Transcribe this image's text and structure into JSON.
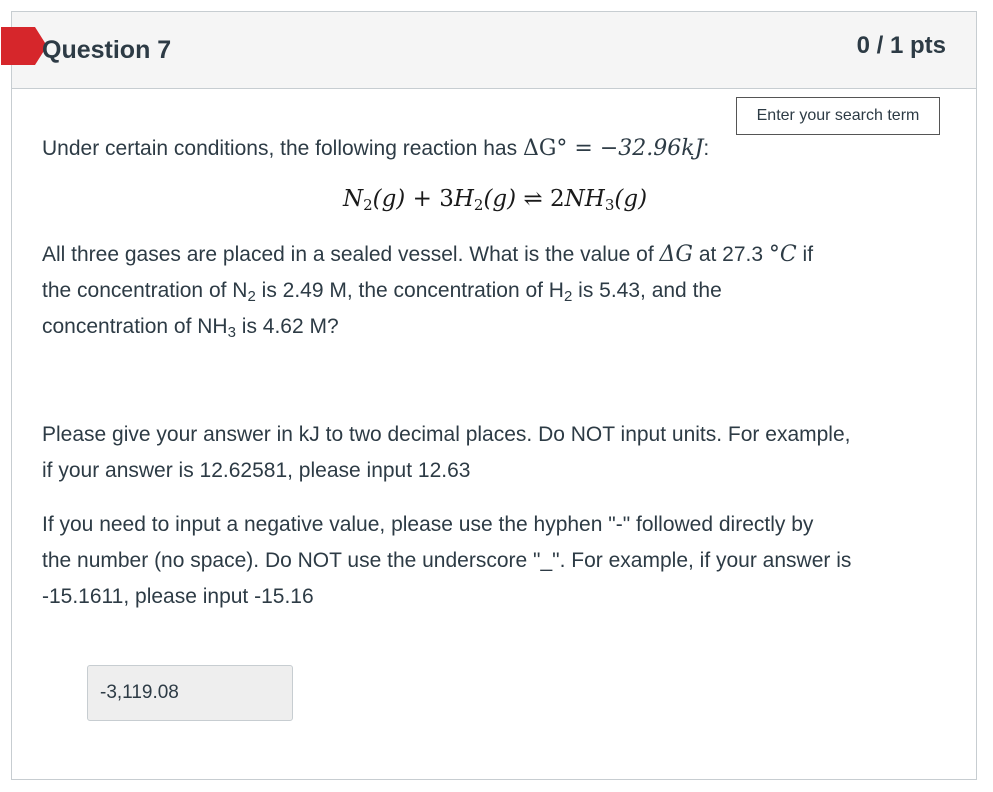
{
  "question": {
    "title": "Question 7",
    "points": "0 / 1 pts"
  },
  "search": {
    "placeholder": "Enter your search term"
  },
  "body": {
    "intro_text": "Under certain conditions, the following reaction has ",
    "delta_g_std": "ΔG°",
    "equals": " = ",
    "delta_g_value": "−32.96kJ",
    "intro_colon": ":",
    "equation": {
      "n2": "N",
      "n2_sub": "2",
      "n2_state": "(g)",
      "plus": " + ",
      "h2_coef": "3",
      "h2": "H",
      "h2_sub": "2",
      "h2_state": "(g)",
      "arrow": "⇌",
      "nh3_coef": "2",
      "nh3": "NH",
      "nh3_sub": "3",
      "nh3_state": "(g)"
    },
    "line1_a": "All three gases are placed in a sealed vessel. What is the value of ",
    "delta_g": "ΔG",
    "line1_b": " at 27.3 ",
    "temp_unit": "°C",
    "line1_c": " if",
    "line2_a": "the concentration of N",
    "line2_sub1": "2",
    "line2_b": " is 2.49 M, the concentration of H",
    "line2_sub2": "2",
    "line2_c": " is 5.43, and the",
    "line3_a": "concentration of NH",
    "line3_sub": "3",
    "line3_b": " is 4.62 M?",
    "instr1_line1": "Please give your answer in kJ to two decimal places. Do NOT input units. For example,",
    "instr1_line2": "if your answer is 12.62581, please input 12.63",
    "instr2_line1": "If you need to input a negative value, please use the hyphen \"-\" followed directly by",
    "instr2_line2": "the number (no space). Do NOT use the underscore \"_\". For example, if your answer is",
    "instr2_line3": "-15.1611, please input -15.16"
  },
  "answer": {
    "value": "-3,119.08"
  },
  "colors": {
    "flag": "#d6262b",
    "text": "#2d3b45",
    "header_bg": "#f5f5f5",
    "border": "#c7cdd1"
  },
  "icons": {
    "flag": "incorrect-flag-icon"
  }
}
